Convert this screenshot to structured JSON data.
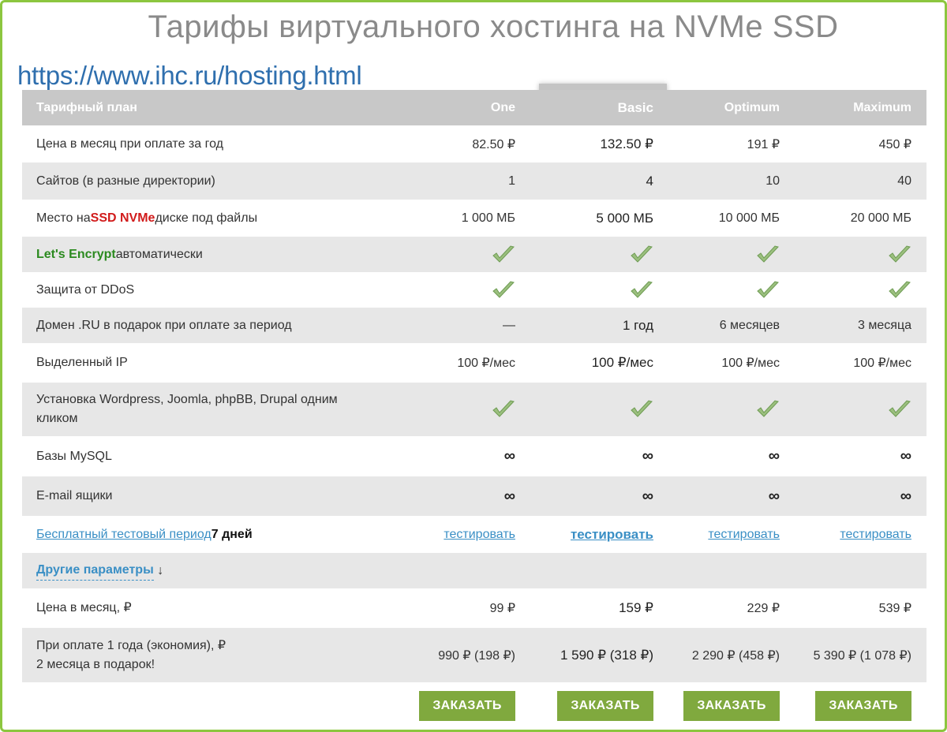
{
  "title": "Тарифы виртуального хостинга на NVMe SSD",
  "url": "https://www.ihc.ru/hosting.html",
  "table": {
    "header": {
      "label": "Тарифный план",
      "one": "One",
      "basic": "Basic",
      "optimum": "Optimum",
      "maximum": "Maximum"
    },
    "rows": [
      {
        "label": "Цена в месяц при оплате за год",
        "one": "82.50 ₽",
        "basic": "132.50 ₽",
        "optimum": "191 ₽",
        "maximum": "450 ₽"
      },
      {
        "label": "Сайтов (в разные директории)",
        "one": "1",
        "basic": "4",
        "optimum": "10",
        "maximum": "40"
      },
      {
        "label_pre": "Место на ",
        "label_hl": "SSD NVMe",
        "label_post": " диске под файлы",
        "one": "1 000 МБ",
        "basic": "5 000 МБ",
        "optimum": "10 000 МБ",
        "maximum": "20 000 МБ"
      },
      {
        "label_hl": "Let's Encrypt",
        "label_post": " автоматически"
      },
      {
        "label": "Защита от DDoS"
      },
      {
        "label": "Домен .RU в подарок при оплате за период",
        "one": "—",
        "basic": "1 год",
        "optimum": "6 месяцев",
        "maximum": "3 месяца"
      },
      {
        "label": "Выделенный IP",
        "one": "100 ₽/мес",
        "basic": "100 ₽/мес",
        "optimum": "100 ₽/мес",
        "maximum": "100 ₽/мес"
      },
      {
        "label": "Установка Wordpress, Joomla, phpBB, Drupal одним кликом"
      },
      {
        "label": "Базы MySQL",
        "one": "∞",
        "basic": "∞",
        "optimum": "∞",
        "maximum": "∞"
      },
      {
        "label": "E-mail ящики",
        "one": "∞",
        "basic": "∞",
        "optimum": "∞",
        "maximum": "∞"
      },
      {
        "label_link": "Бесплатный тестовый период",
        "label_bold": " 7 дней",
        "one": "тестировать",
        "basic": "тестировать",
        "optimum": "тестировать",
        "maximum": "тестировать"
      },
      {
        "label_link": "Другие параметры",
        "arrow": "↓"
      },
      {
        "label": "Цена в месяц, ₽",
        "one": "99 ₽",
        "basic": "159 ₽",
        "optimum": "229 ₽",
        "maximum": "539 ₽"
      },
      {
        "label_line1": "При оплате 1 года (экономия), ₽",
        "label_line2": "2 месяца в подарок!",
        "one": "990 ₽ (198 ₽)",
        "basic": "1 590 ₽ (318 ₽)",
        "optimum": "2 290 ₽ (458 ₽)",
        "maximum": "5 390 ₽ (1 078 ₽)"
      }
    ],
    "order_label": "ЗАКАЗАТЬ"
  },
  "colors": {
    "accent_green": "#80a93e",
    "border_green": "#8cc63f",
    "header_gray": "#c8c8c8",
    "link_blue": "#3a8fc5",
    "highlight_red": "#d11b1b"
  },
  "icons": {
    "check": "check-icon"
  }
}
